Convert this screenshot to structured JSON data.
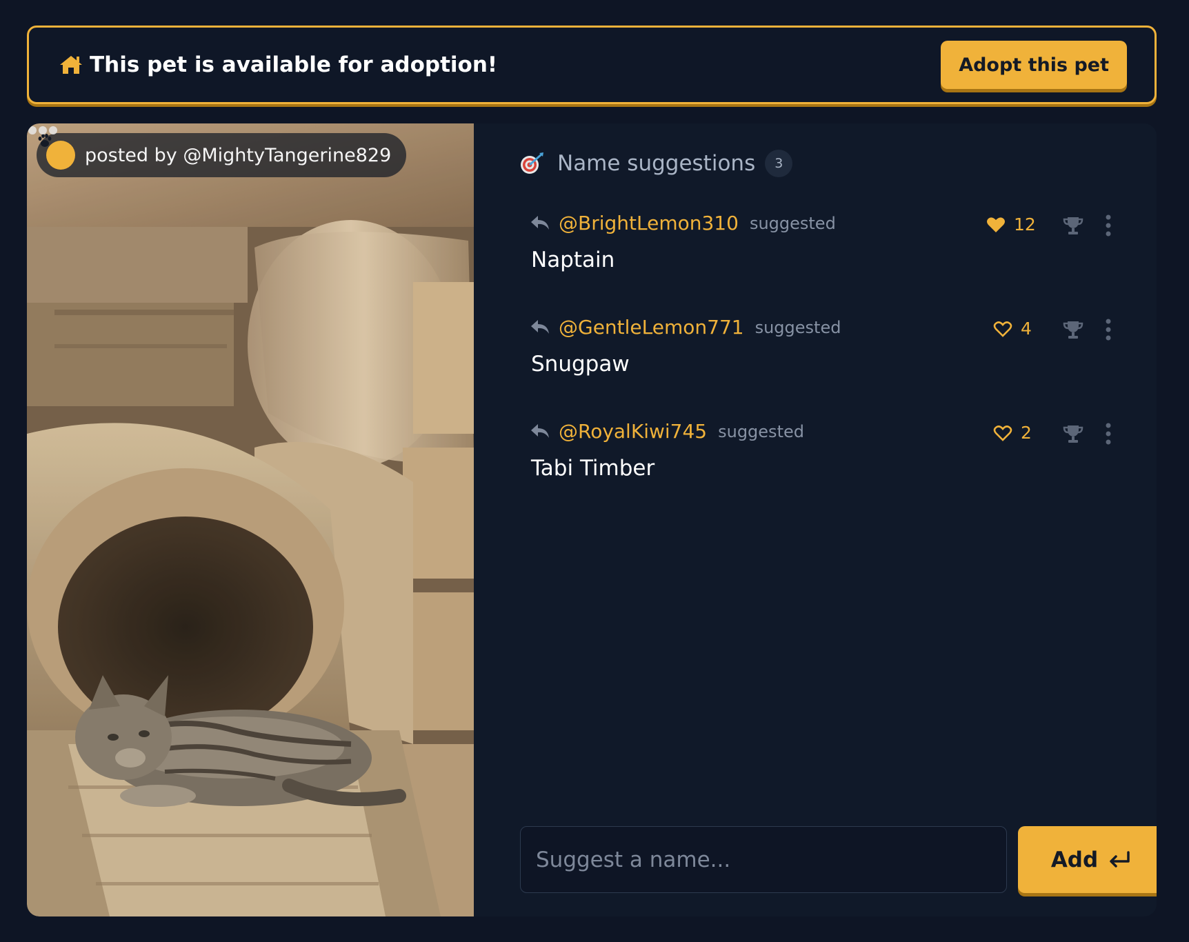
{
  "banner": {
    "message": "This pet is available for adoption!",
    "adopt_label": "Adopt this pet",
    "icon": "home-icon"
  },
  "post": {
    "posted_by": "posted by @MightyTangerine829",
    "photo_subject": "tabby cat on wooden logs"
  },
  "suggestions_panel": {
    "title": "Name suggestions",
    "count": "3",
    "items": [
      {
        "user": "@BrightLemon310",
        "suggested_label": "suggested",
        "name": "Naptain",
        "likes": "12",
        "liked": true
      },
      {
        "user": "@GentleLemon771",
        "suggested_label": "suggested",
        "name": "Snugpaw",
        "likes": "4",
        "liked": false
      },
      {
        "user": "@RoyalKiwi745",
        "suggested_label": "suggested",
        "name": "Tabi Timber",
        "likes": "2",
        "liked": false
      }
    ]
  },
  "input": {
    "placeholder": "Suggest a name...",
    "add_label": "Add"
  },
  "colors": {
    "accent": "#f0b23a",
    "background": "#0e1525",
    "panel": "#101929"
  }
}
